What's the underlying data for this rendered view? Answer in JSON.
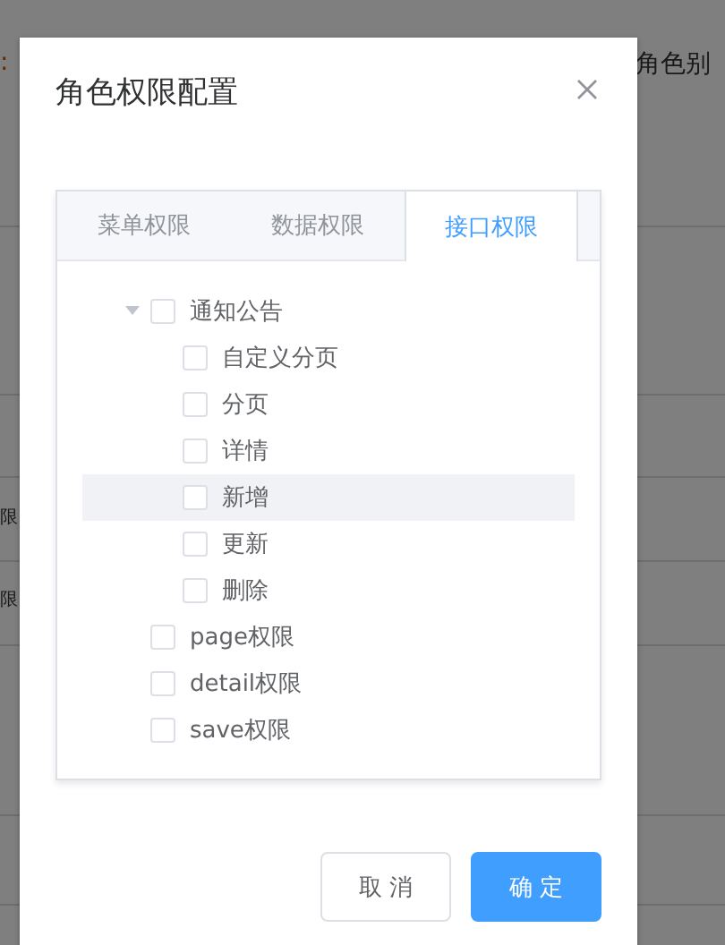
{
  "background": {
    "top_label": ":",
    "top_right_label": "角色别",
    "row_labels": [
      "限",
      "限"
    ]
  },
  "dialog": {
    "title": "角色权限配置",
    "tabs": [
      {
        "label": "菜单权限",
        "selected": false
      },
      {
        "label": "数据权限",
        "selected": false
      },
      {
        "label": "接口权限",
        "selected": true
      }
    ],
    "tree": [
      {
        "label": "通知公告",
        "checked": false,
        "expanded": true,
        "highlighted": false,
        "children": [
          {
            "label": "自定义分页",
            "checked": false,
            "highlighted": false
          },
          {
            "label": "分页",
            "checked": false,
            "highlighted": false
          },
          {
            "label": "详情",
            "checked": false,
            "highlighted": false
          },
          {
            "label": "新增",
            "checked": false,
            "highlighted": true
          },
          {
            "label": "更新",
            "checked": false,
            "highlighted": false
          },
          {
            "label": "删除",
            "checked": false,
            "highlighted": false
          }
        ]
      },
      {
        "label": "page权限",
        "checked": false,
        "highlighted": false
      },
      {
        "label": "detail权限",
        "checked": false,
        "highlighted": false
      },
      {
        "label": "save权限",
        "checked": false,
        "highlighted": false
      }
    ],
    "buttons": [
      {
        "label": "取 消",
        "kind": "secondary"
      },
      {
        "label": "确 定",
        "kind": "primary"
      }
    ]
  }
}
